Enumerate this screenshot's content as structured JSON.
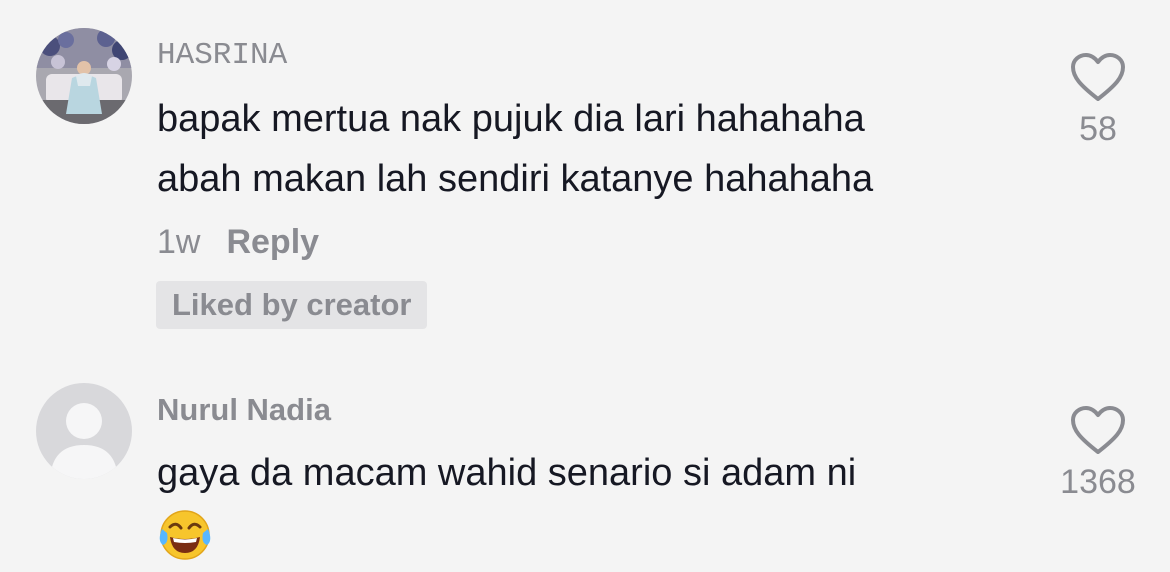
{
  "comments": [
    {
      "username": "HASRINA",
      "text_lines": [
        "bapak mertua nak pujuk dia lari hahahaha",
        "abah makan lah sendiri katanye hahahaha"
      ],
      "time": "1w",
      "reply_label": "Reply",
      "badge": "Liked by creator",
      "likes": "58",
      "avatar": "photo-avatar"
    },
    {
      "username": "Nurul Nadia",
      "text_lines": [
        "gaya da macam wahid senario si adam ni"
      ],
      "emoji": "face-with-tears-of-joy",
      "likes": "1368",
      "avatar": "default-avatar"
    }
  ],
  "icons": {
    "like": "heart-outline-icon"
  },
  "colors": {
    "background": "#f4f4f4",
    "primary_text": "#161823",
    "secondary_text": "#8a8b91",
    "badge_bg": "#e4e4e6"
  }
}
